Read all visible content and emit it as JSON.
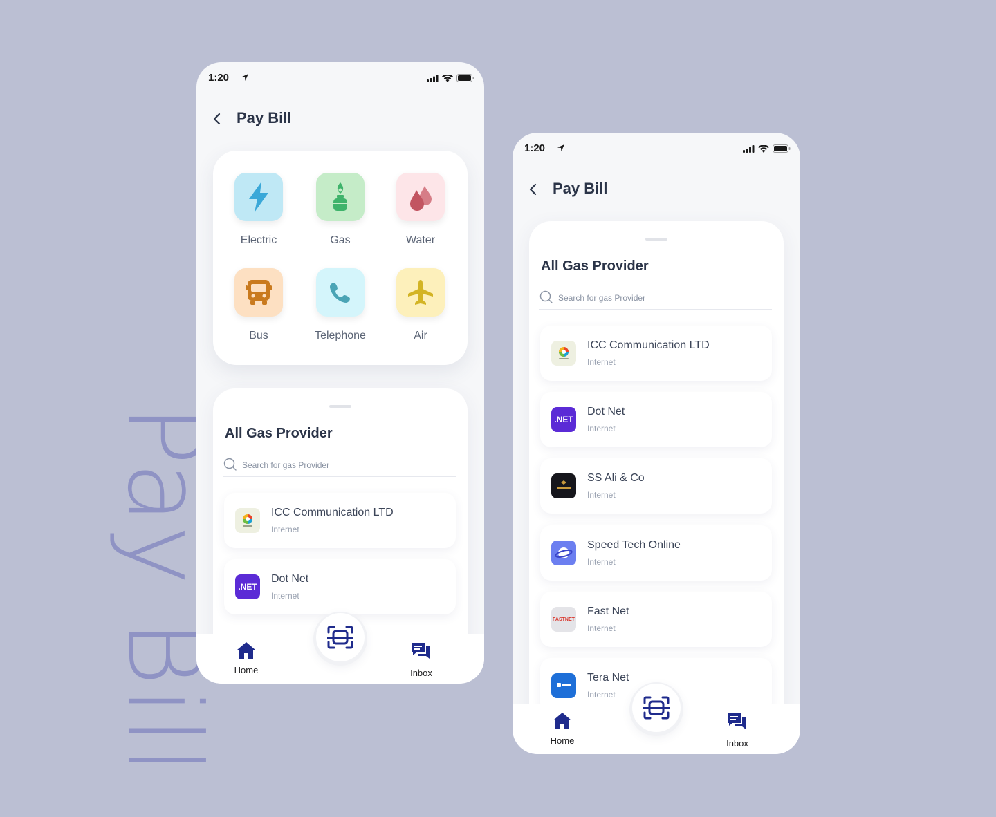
{
  "side_title": "Pay Bill",
  "status": {
    "time": "1:20"
  },
  "header": {
    "title": "Pay Bill"
  },
  "categories": [
    {
      "label": "Electric",
      "icon": "bolt-icon",
      "bg": "#bfe8f5",
      "fg": "#3aa8d8"
    },
    {
      "label": "Gas",
      "icon": "gas-cylinder-icon",
      "bg": "#c5ecc8",
      "fg": "#3fb36b"
    },
    {
      "label": "Water",
      "icon": "water-drop-icon",
      "bg": "#fde5e8",
      "fg": "#cf6b76"
    },
    {
      "label": "Bus",
      "icon": "bus-icon",
      "bg": "#fde0c2",
      "fg": "#c97a1e"
    },
    {
      "label": "Telephone",
      "icon": "phone-icon",
      "bg": "#d4f5fb",
      "fg": "#4aa4b5"
    },
    {
      "label": "Air",
      "icon": "airplane-icon",
      "bg": "#fdf0bb",
      "fg": "#d3b425"
    }
  ],
  "providers_sheet": {
    "title": "All Gas Provider",
    "search_placeholder": "Search for gas Provider"
  },
  "providers": [
    {
      "name": "ICC Communication LTD",
      "type": "Internet",
      "logo": "icc-logo",
      "logo_text": ""
    },
    {
      "name": "Dot Net",
      "type": "Internet",
      "logo": "dotnet-logo",
      "logo_text": ".NET"
    },
    {
      "name": "SS Ali & Co",
      "type": "Internet",
      "logo": "ss-ali-logo",
      "logo_text": ""
    },
    {
      "name": "Speed Tech Online",
      "type": "Internet",
      "logo": "speed-tech-logo",
      "logo_text": ""
    },
    {
      "name": "Fast Net",
      "type": "Internet",
      "logo": "fast-net-logo",
      "logo_text": "FASTNET"
    },
    {
      "name": "Tera Net",
      "type": "Internet",
      "logo": "tera-net-logo",
      "logo_text": ""
    }
  ],
  "nav": {
    "home": "Home",
    "inbox": "Inbox",
    "accent": "#1f2b8c"
  }
}
